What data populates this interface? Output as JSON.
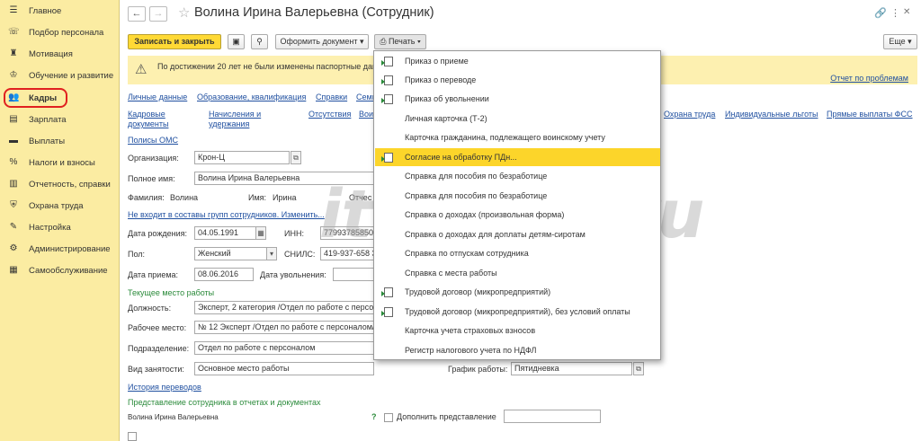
{
  "sidebar": {
    "items": [
      {
        "label": "Главное",
        "icon": "menu-icon"
      },
      {
        "label": "Подбор персонала",
        "icon": "phone-icon"
      },
      {
        "label": "Мотивация",
        "icon": "trophy-icon"
      },
      {
        "label": "Обучение и развитие",
        "icon": "graduation-icon"
      },
      {
        "label": "Кадры",
        "icon": "people-icon"
      },
      {
        "label": "Зарплата",
        "icon": "document-icon"
      },
      {
        "label": "Выплаты",
        "icon": "wallet-icon"
      },
      {
        "label": "Налоги и взносы",
        "icon": "percent-icon"
      },
      {
        "label": "Отчетность, справки",
        "icon": "report-icon"
      },
      {
        "label": "Охрана труда",
        "icon": "shield-icon"
      },
      {
        "label": "Настройка",
        "icon": "wrench-icon"
      },
      {
        "label": "Администрирование",
        "icon": "gear-icon"
      },
      {
        "label": "Самообслуживание",
        "icon": "self-service-icon"
      }
    ],
    "active": "Кадры"
  },
  "header": {
    "title": "Волина Ирина Валерьевна (Сотрудник)"
  },
  "toolbar": {
    "save_close": "Записать и закрыть",
    "create_document": "Оформить документ",
    "print": "Печать",
    "more": "Еще"
  },
  "warning": {
    "text": "По достижении 20 лет не были изменены паспортные дан",
    "link": "Отчет по проблемам"
  },
  "tabs": {
    "row1": [
      "Личные данные",
      "Образование, квалификация",
      "Справки",
      "Семь"
    ],
    "row2a": [
      "Кадровые",
      "Начисления и",
      "Отсутствия",
      "Воин"
    ],
    "row2b": [
      "документы",
      "удержания"
    ],
    "row2_right": [
      "Охрана труда",
      "Индивидуальные льготы",
      "Прямые выплаты ФСС"
    ],
    "row3": [
      "Полисы ОМС"
    ]
  },
  "form": {
    "org_label": "Организация:",
    "org_value": "Крон-Ц",
    "fullname_label": "Полное имя:",
    "fullname_value": "Волина Ирина Валерьевна",
    "surname_label": "Фамилия:",
    "surname_value": "Волина",
    "name_label": "Имя:",
    "name_value": "Ирина",
    "patronymic_label": "Отчес",
    "groups_link": "Не входит в составы групп сотрудников. Изменить...",
    "birth_label": "Дата рождения:",
    "birth_value": "04.05.1991",
    "inn_label": "ИНН:",
    "inn_value": "77993785850",
    "gender_label": "Пол:",
    "gender_value": "Женский",
    "snils_label": "СНИЛС:",
    "snils_value": "419-937-658 3",
    "hire_label": "Дата приема:",
    "hire_value": "08.06.2016",
    "dismiss_label": "Дата увольнения:",
    "current_job_section": "Текущее место работы",
    "position_label": "Должность:",
    "position_value": "Эксперт, 2 категория /Отдел по работе с персон",
    "workplace_label": "Рабочее место:",
    "workplace_value": "№ 12 Эксперт /Отдел по работе с персоналом/",
    "dept_label": "Подразделение:",
    "dept_value": "Отдел по работе с персоналом",
    "employment_label": "Вид занятости:",
    "employment_value": "Основное место работы",
    "schedule_label": "График работы:",
    "schedule_value": "Пятидневка",
    "history_link": "История переводов",
    "repr_section": "Представление сотрудника в отчетах и документах",
    "repr_name": "Волина Ирина Валерьевна",
    "repr_help": "?",
    "repr_extend": "Дополнить представление"
  },
  "print_menu": {
    "items": [
      {
        "label": "Приказ о приеме",
        "icon": true
      },
      {
        "label": "Приказ о переводе",
        "icon": true
      },
      {
        "label": "Приказ об увольнении",
        "icon": true
      },
      {
        "label": "Личная карточка (Т-2)",
        "icon": false
      },
      {
        "label": "Карточка гражданина, подлежащего воинскому учету",
        "icon": false
      },
      {
        "label": "Согласие на обработку ПДн...",
        "icon": true
      },
      {
        "label": "Справка для пособия по безработице",
        "icon": false
      },
      {
        "label": "Справка для пособия по безработице",
        "icon": false
      },
      {
        "label": "Справка о доходах (произвольная форма)",
        "icon": false
      },
      {
        "label": "Справка о доходах для доплаты детям-сиротам",
        "icon": false
      },
      {
        "label": "Справка по отпускам сотрудника",
        "icon": false
      },
      {
        "label": "Справка с места работы",
        "icon": false
      },
      {
        "label": "Трудовой договор (микропредприятий)",
        "icon": true
      },
      {
        "label": "Трудовой договор (микропредприятий), без условий оплаты",
        "icon": true
      },
      {
        "label": "Карточка учета страховых взносов",
        "icon": false
      },
      {
        "label": "Регистр налогового учета по НДФЛ",
        "icon": false
      }
    ],
    "selected_index": 5
  },
  "watermark": "itsutem.ru",
  "colors": {
    "sidebar_bg": "#fbeca2",
    "primary_button": "#ffd935",
    "menu_highlight": "#fcd52a",
    "link": "#2050a0",
    "section_green": "#2a8a3a",
    "warning_bg": "#fdf0b0",
    "active_outline": "#e02020"
  }
}
